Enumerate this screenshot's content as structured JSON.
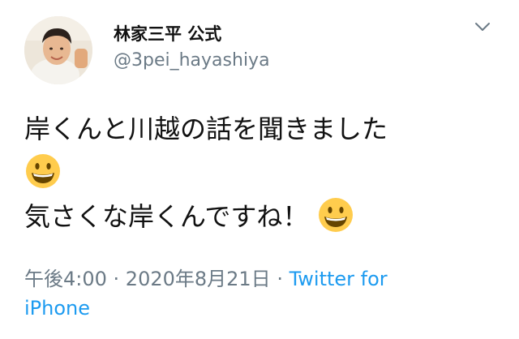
{
  "tweet": {
    "author_name": "林家三平 公式",
    "handle": "@3pei_hayashiya",
    "body_line1": "岸くんと川越の話を聞きました",
    "body_line3": "気さくな岸くんですね！",
    "emoji_icon": "grinning-face",
    "meta": {
      "time": "午後4:00",
      "sep1": " · ",
      "date": "2020年8月21日",
      "sep2": " · ",
      "source": "Twitter for iPhone"
    }
  },
  "colors": {
    "text": "#111111",
    "muted": "#6b7a86",
    "link": "#1d9bf0"
  }
}
